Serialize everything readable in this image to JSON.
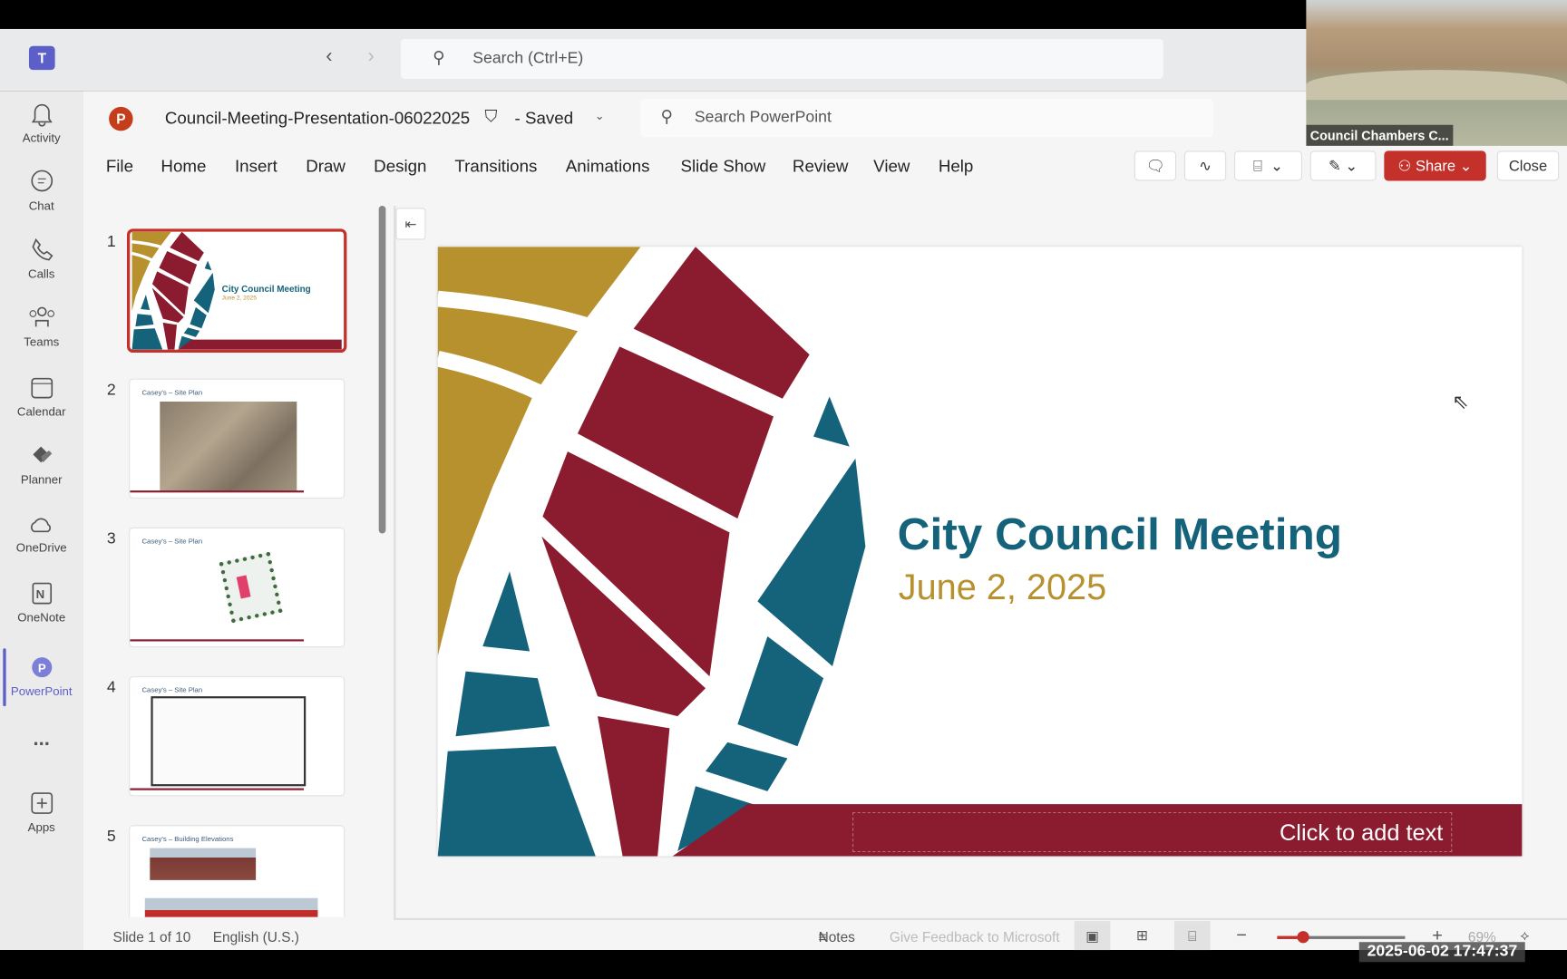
{
  "teams": {
    "search_placeholder": "Search (Ctrl+E)",
    "rail": [
      {
        "label": "Activity",
        "icon": "bell-icon"
      },
      {
        "label": "Chat",
        "icon": "chat-icon"
      },
      {
        "label": "Calls",
        "icon": "phone-icon"
      },
      {
        "label": "Teams",
        "icon": "teams-icon"
      },
      {
        "label": "Calendar",
        "icon": "calendar-icon"
      },
      {
        "label": "Planner",
        "icon": "planner-icon"
      },
      {
        "label": "OneDrive",
        "icon": "cloud-icon"
      },
      {
        "label": "OneNote",
        "icon": "onenote-icon"
      },
      {
        "label": "PowerPoint",
        "icon": "powerpoint-icon"
      },
      {
        "label": "...",
        "icon": "more-icon"
      },
      {
        "label": "Apps",
        "icon": "apps-icon"
      }
    ]
  },
  "video": {
    "label": "Council Chambers C..."
  },
  "ppt": {
    "file_name": "Council-Meeting-Presentation-06022025",
    "save_status": "- Saved",
    "search_placeholder": "Search PowerPoint",
    "menu": [
      "File",
      "Home",
      "Insert",
      "Draw",
      "Design",
      "Transitions",
      "Animations",
      "Slide Show",
      "Review",
      "View",
      "Help"
    ],
    "share_label": "Share",
    "close_label": "Close"
  },
  "thumbnails": [
    {
      "num": "1",
      "title": "City Council Meeting",
      "subtitle": "June 2, 2025"
    },
    {
      "num": "2",
      "title": "Casey's – Site Plan"
    },
    {
      "num": "3",
      "title": "Casey's – Site Plan"
    },
    {
      "num": "4",
      "title": "Casey's – Site Plan"
    },
    {
      "num": "5",
      "title": "Casey's – Building Elevations"
    }
  ],
  "slide": {
    "title": "City Council Meeting",
    "subtitle": "June 2, 2025",
    "footer_placeholder": "Click to add text",
    "colors": {
      "gold": "#b8912f",
      "maroon": "#8b1c2f",
      "teal": "#14637a"
    }
  },
  "status": {
    "slide_count": "Slide 1 of 10",
    "language": "English (U.S.)",
    "notes": "Notes",
    "feedback": "Give Feedback to Microsoft",
    "zoom": "69%",
    "zoom_fraction": 0.2
  },
  "timestamp": "2025-06-02 17:47:37"
}
